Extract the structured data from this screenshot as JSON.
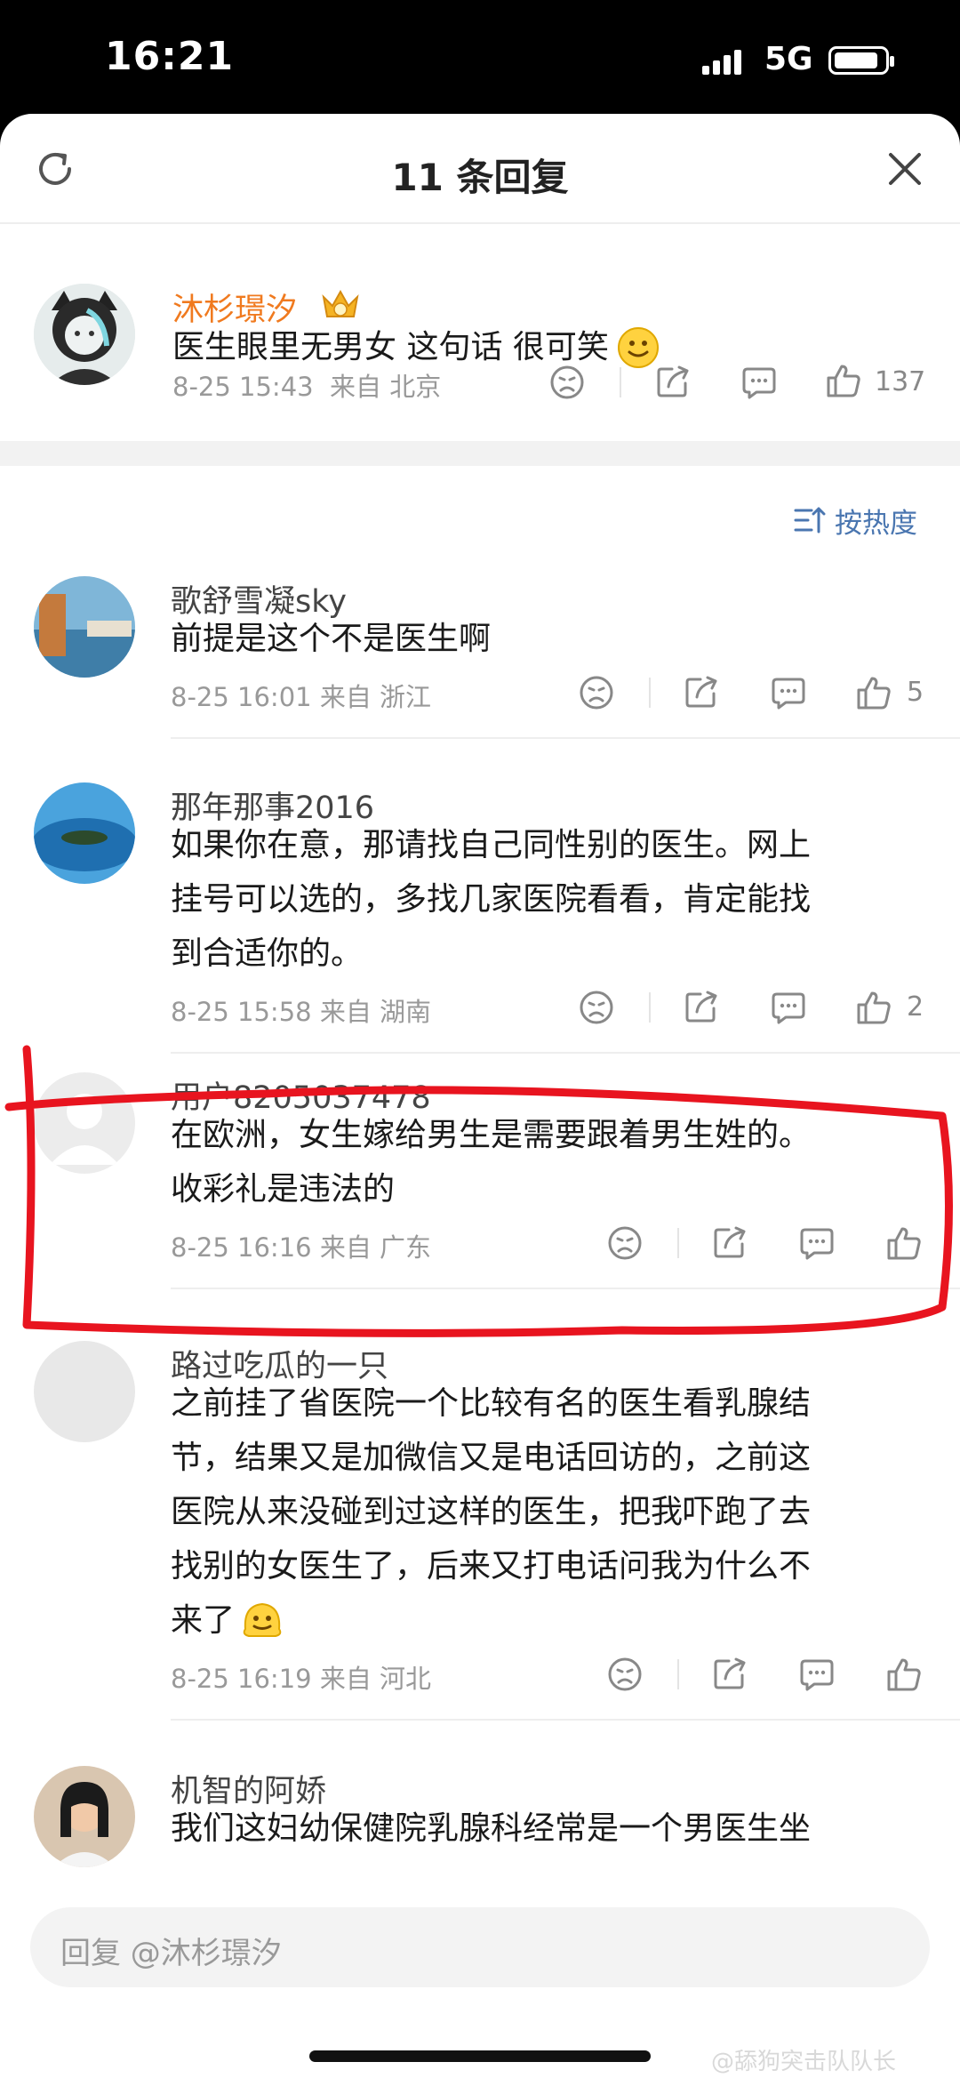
{
  "status_bar": {
    "time": "16:21",
    "network": "5G"
  },
  "header": {
    "title": "11 条回复"
  },
  "original": {
    "name": "沐杉璟汐",
    "text": "医生眼里无男女 这句话 很可笑",
    "date": "8-25 15:43",
    "from": "来自 北京",
    "likes": "137"
  },
  "sort_label": "按热度",
  "replies": [
    {
      "name": "歌舒雪凝sky",
      "lines": [
        "前提是这个不是医生啊"
      ],
      "date": "8-25 16:01",
      "from": "来自 浙江",
      "likes": "5"
    },
    {
      "name": "那年那事2016",
      "lines": [
        "如果你在意，那请找自己同性别的医生。网上",
        "挂号可以选的，多找几家医院看看，肯定能找",
        "到合适你的。"
      ],
      "date": "8-25 15:58",
      "from": "来自 湖南",
      "likes": "2"
    },
    {
      "name": "用户8205037478",
      "lines": [
        "在欧洲，女生嫁给男生是需要跟着男生姓的。",
        "收彩礼是违法的"
      ],
      "date": "8-25 16:16",
      "from": "来自 广东",
      "likes": ""
    },
    {
      "name": "路过吃瓜的一只",
      "lines": [
        "之前挂了省医院一个比较有名的医生看乳腺结",
        "节，结果又是加微信又是电话回访的，之前这",
        "医院从来没碰到过这样的医生，把我吓跑了去",
        "找别的女医生了，后来又打电话问我为什么不",
        "来了"
      ],
      "date": "8-25 16:19",
      "from": "来自 河北",
      "likes": ""
    },
    {
      "name": "机智的阿娇",
      "lines": [
        "我们这妇幼保健院乳腺科经常是一个男医生坐"
      ],
      "date": "",
      "from": "",
      "likes": ""
    }
  ],
  "reply_input": {
    "placeholder": "回复 @沐杉璟汐"
  },
  "watermark": "@舔狗突击队队长",
  "colors": {
    "accent": "#4a76b0",
    "crown": "#f0a020",
    "annotation": "#e8141f"
  }
}
